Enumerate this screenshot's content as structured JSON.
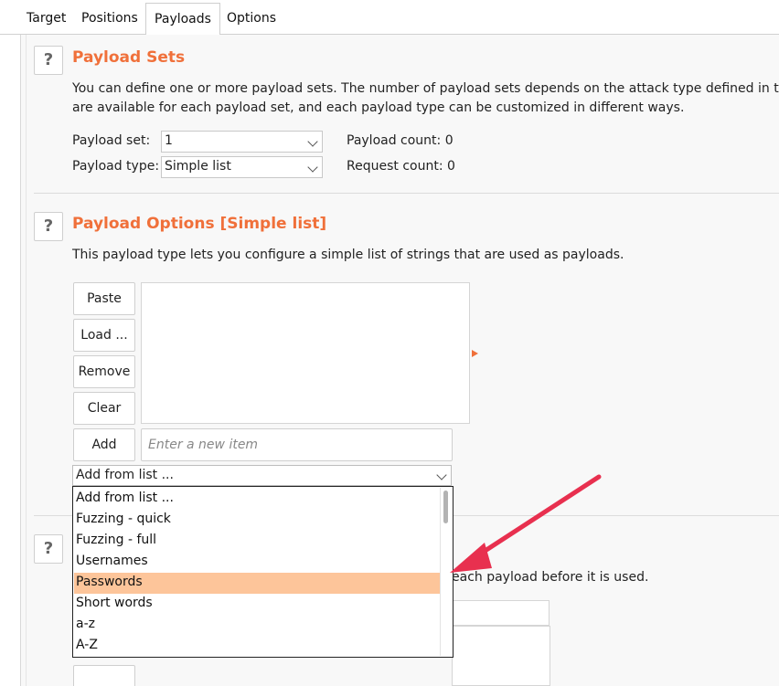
{
  "tabs": [
    {
      "label": "Target"
    },
    {
      "label": "Positions"
    },
    {
      "label": "Payloads",
      "active": true
    },
    {
      "label": "Options"
    }
  ],
  "help_label": "?",
  "payload_sets": {
    "title": "Payload Sets",
    "desc_line1": "You can define one or more payload sets. The number of payload sets depends on the attack type defined in the",
    "desc_line2": "are available for each payload set, and each payload type can be customized in different ways.",
    "payload_set_label": "Payload set:",
    "payload_set_value": "1",
    "payload_type_label": "Payload type:",
    "payload_type_value": "Simple list",
    "payload_count": "Payload count: 0",
    "request_count": "Request count: 0"
  },
  "payload_options": {
    "title": "Payload Options [Simple list]",
    "desc": "This payload type lets you configure a simple list of strings that are used as payloads.",
    "buttons": {
      "paste": "Paste",
      "load": "Load ...",
      "remove": "Remove",
      "clear": "Clear",
      "add": "Add"
    },
    "new_item_placeholder": "Enter a new item",
    "add_from_list_value": "Add from list ..."
  },
  "dropdown": {
    "items": [
      {
        "label": "Add from list ..."
      },
      {
        "label": "Fuzzing - quick"
      },
      {
        "label": "Fuzzing - full"
      },
      {
        "label": "Usernames"
      },
      {
        "label": "Passwords",
        "selected": true
      },
      {
        "label": "Short words"
      },
      {
        "label": "a-z"
      },
      {
        "label": "A-Z"
      }
    ]
  },
  "payload_processing": {
    "desc_fragment": "each payload before it is used."
  },
  "colors": {
    "accent": "#f0703a",
    "selected_row": "#fdc59a",
    "annotation_arrow": "#e8304f"
  }
}
